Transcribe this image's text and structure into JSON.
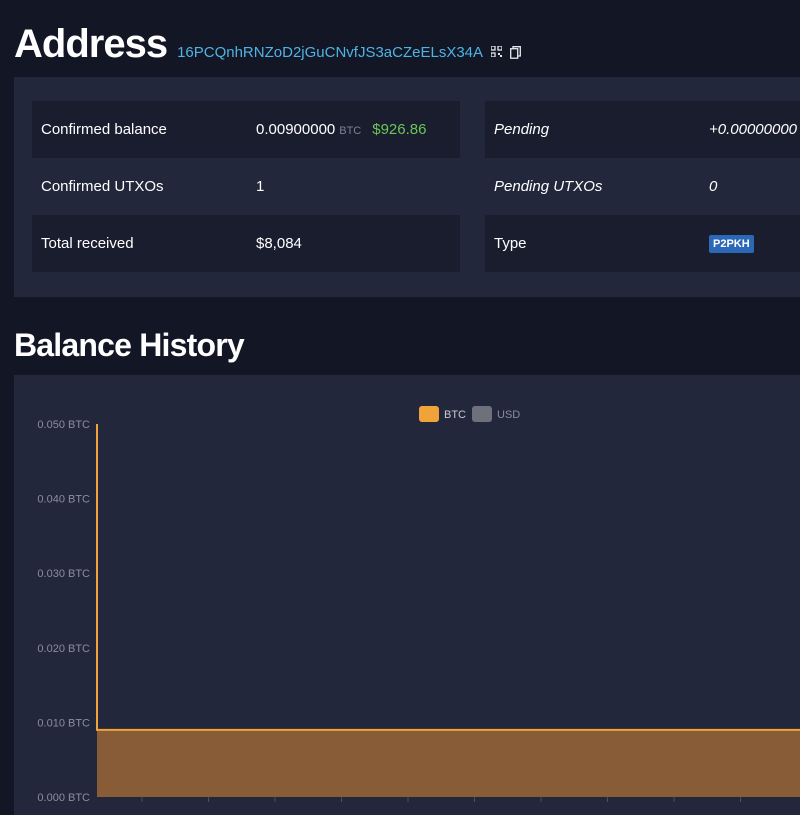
{
  "page": {
    "title": "Address",
    "address": "16PCQnhRNZoD2jGuCNvfJS3aCZeELsX34A",
    "icons": [
      "qr-code-icon",
      "copy-icon"
    ]
  },
  "summary": {
    "left": [
      {
        "label": "Confirmed balance",
        "value": "0.00900000",
        "unit": "BTC",
        "fiat": "$926.86"
      },
      {
        "label": "Confirmed UTXOs",
        "value": "1"
      },
      {
        "label": "Total received",
        "value": "$8,084"
      }
    ],
    "right": [
      {
        "label": "Pending",
        "value": "+0.00000000"
      },
      {
        "label": "Pending UTXOs",
        "value": "0"
      },
      {
        "label": "Type",
        "badge": "P2PKH"
      }
    ]
  },
  "balance_history": {
    "title": "Balance History"
  },
  "colors": {
    "background": "#131624",
    "panel": "#23273b",
    "stripe": "#1a1d2e",
    "address_link": "#4fb3e6",
    "fiat_positive": "#6bc55a",
    "btc_series": "#f0a338",
    "btc_fill": "#875c36",
    "usd_series": "#6e717c",
    "badge": "#2c68b8"
  },
  "chart_data": {
    "type": "area",
    "legend": {
      "position": "top-center",
      "entries": [
        "BTC",
        "USD"
      ]
    },
    "y_ticks": [
      "0.050 BTC",
      "0.040 BTC",
      "0.030 BTC",
      "0.020 BTC",
      "0.010 BTC",
      "0.000 BTC"
    ],
    "ylim": [
      0,
      0.05
    ],
    "grid": false,
    "series": [
      {
        "name": "BTC",
        "values": [
          0.05,
          0.009,
          0.009,
          0.009,
          0.009,
          0.009,
          0.009,
          0.009,
          0.009,
          0.009,
          0.009,
          0.009
        ]
      },
      {
        "name": "USD",
        "values": []
      }
    ]
  }
}
